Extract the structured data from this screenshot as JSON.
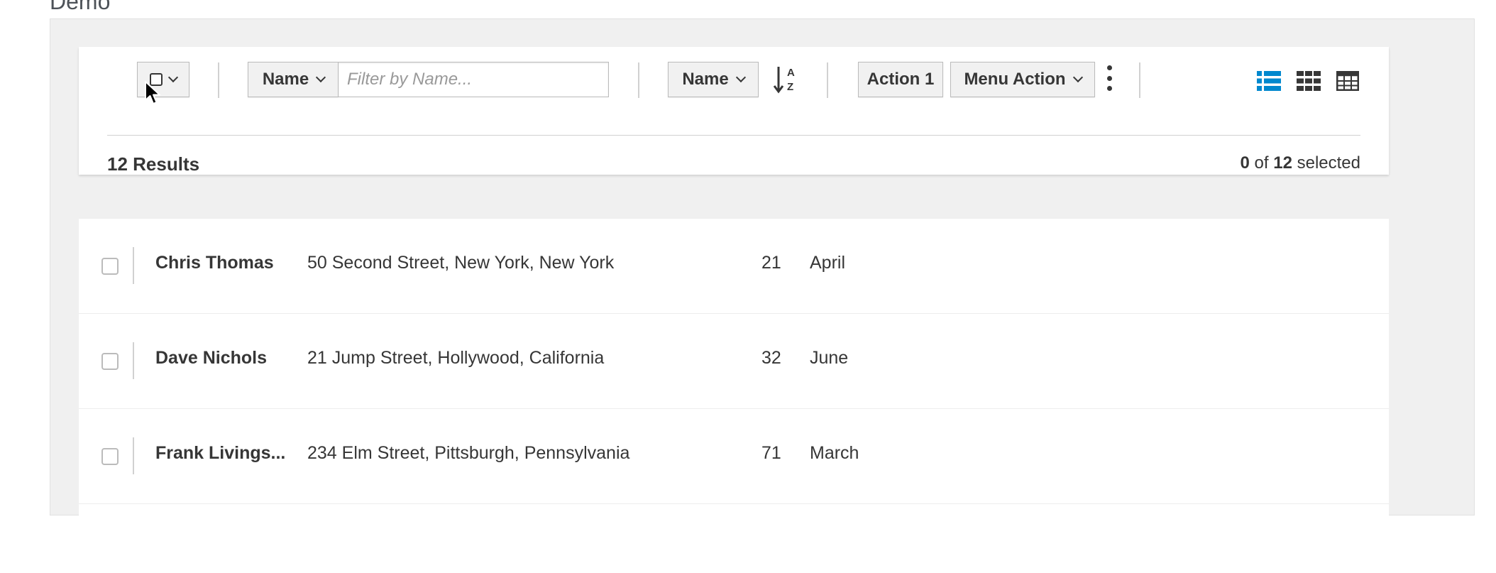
{
  "page": {
    "heading": "Demo"
  },
  "toolbar": {
    "filter": {
      "field_label": "Name",
      "placeholder": "Filter by Name..."
    },
    "sort": {
      "field_label": "Name",
      "direction": "ascending"
    },
    "actions": {
      "action1_label": "Action 1",
      "menu_action_label": "Menu Action"
    },
    "views": [
      "list-view",
      "card-view",
      "table-view"
    ],
    "active_view": "list-view"
  },
  "summary": {
    "results_label": "12 Results",
    "selected_count": "0",
    "of_word": "of",
    "total_count": "12",
    "selected_word": "selected"
  },
  "rows": [
    {
      "name": "Chris Thomas",
      "address": "50 Second Street, New York, New York",
      "age": "21",
      "month": "April"
    },
    {
      "name": "Dave Nichols",
      "address": "21 Jump Street, Hollywood, California",
      "age": "32",
      "month": "June"
    },
    {
      "name": "Frank Livings...",
      "address": "234 Elm Street, Pittsburgh, Pennsylvania",
      "age": "71",
      "month": "March"
    }
  ],
  "colors": {
    "accent": "#0088ce",
    "text": "#363636",
    "border": "#bbbbbb",
    "panel_bg": "#f0f0f0"
  }
}
